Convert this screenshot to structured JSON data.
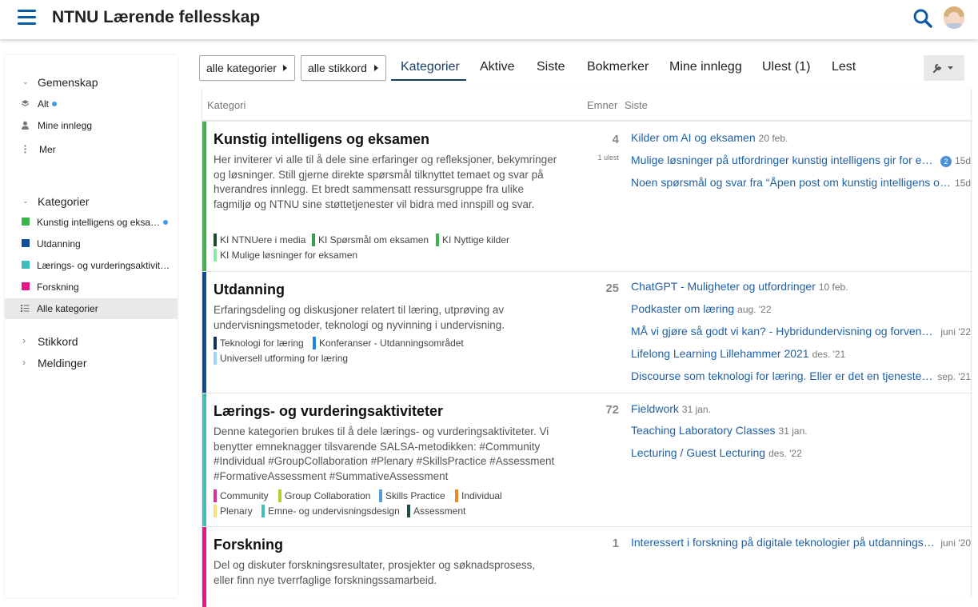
{
  "site_title": "NTNU Lærende fellesskap",
  "sidebar": {
    "community_label": "Gemenskap",
    "community_items": [
      {
        "label": "Alt",
        "icon": "layers-icon",
        "has_dot": true
      },
      {
        "label": "Mine innlegg",
        "icon": "user-icon",
        "has_dot": false
      },
      {
        "label": "Mer",
        "icon": "more-vertical-icon",
        "has_dot": false
      }
    ],
    "categories_label": "Kategorier",
    "category_items": [
      {
        "label": "Kunstig intelligens og eksa…",
        "color": "#3ab54a",
        "has_dot": true
      },
      {
        "label": "Utdanning",
        "color": "#0e4d9b",
        "has_dot": false
      },
      {
        "label": "Lærings- og vurderingsaktivit…",
        "color": "#3ebfbd",
        "has_dot": false
      },
      {
        "label": "Forskning",
        "color": "#e9158c",
        "has_dot": false
      },
      {
        "label": "Alle kategorier",
        "icon": "list-icon",
        "active": true
      }
    ],
    "tags_label": "Stikkord",
    "messages_label": "Meldinger"
  },
  "nav": {
    "categories_dropdown": "alle kategorier",
    "tags_dropdown": "alle stikkord",
    "tabs": [
      "Kategorier",
      "Aktive",
      "Siste",
      "Bokmerker",
      "Mine innlegg",
      "Ulest (1)",
      "Lest"
    ],
    "active_tab": "Kategorier"
  },
  "table_headers": {
    "category": "Kategori",
    "topics": "Emner",
    "latest": "Siste"
  },
  "categories": [
    {
      "title": "Kunstig intelligens og eksamen",
      "color": "#3ab54a",
      "description": "Her inviterer vi alle til å dele sine erfaringer og refleksjoner, bekymringer og løsninger. Still gjerne direkte spørsmål tilknyttet temaet og svar på hverandres innlegg. Et bredt sammensatt ressursgruppe fra ulike fagmiljø og NTNU sine støttetjenester vil bidra med innspill og svar.",
      "subcategories": [
        {
          "label": "KI NTNUere i media",
          "color": "#1f4d2c"
        },
        {
          "label": "KI Spørsmål om eksamen",
          "color": "#3a9d53"
        },
        {
          "label": "KI Nyttige kilder",
          "color": "#3ab54a"
        },
        {
          "label": "KI Mulige løsninger for eksamen",
          "color": "#8de6a0"
        }
      ],
      "topic_count": "4",
      "unread": "1 ulest",
      "topics": [
        {
          "title": "Kilder om AI og eksamen",
          "date": "20 feb.",
          "badge": ""
        },
        {
          "title": "Mulige løsninger på utfordringer kunstig intelligens gir for eksamen",
          "date": "15d",
          "badge": "2"
        },
        {
          "title": "Noen spørsmål og svar fra “Åpen post om kunstig intelligens og eksamen”",
          "date": "15d",
          "badge": ""
        }
      ]
    },
    {
      "title": "Utdanning",
      "color": "#0e4d9b",
      "description": "Erfaringsdeling og diskusjoner relatert til læring, utprøving av undervisningsmetoder, teknologi og nyvinning i undervisning.",
      "subcategories": [
        {
          "label": "Teknologi for læring",
          "color": "#15315b"
        },
        {
          "label": "Konferanser - Utdanningsområdet",
          "color": "#1b86e6"
        },
        {
          "label": "Universell utforming for læring",
          "color": "#9fd3f5"
        }
      ],
      "topic_count": "25",
      "unread": "",
      "topics": [
        {
          "title": "ChatGPT - Muligheter og utfordringer",
          "date": "10 feb.",
          "badge": ""
        },
        {
          "title": "Podkaster om læring",
          "date": "aug. '22",
          "badge": ""
        },
        {
          "title": "MÅ vi gjøre så godt vi kan? - Hybridundervisning og forventninger",
          "date": "juni '22",
          "badge": ""
        },
        {
          "title": "Lifelong Learning Lillehammer 2021",
          "date": "des. '21",
          "badge": ""
        },
        {
          "title": "Discourse som teknologi for læring. Eller er det en tjeneste? Eller begge deler?",
          "date": "sep. '21",
          "badge": ""
        }
      ]
    },
    {
      "title": "Lærings- og vurderingsaktiviteter",
      "color": "#3ebfbd",
      "description": "Denne kategorien brukes til å dele lærings- og vurderingsaktiviteter. Vi benytter emneknagger tilsvarende SALSA-metodikken: #Community #Individual #GroupCollaboration #Plenary #SkillsPractice #Assessment #FormativeAssessment #SummativeAssessment",
      "subcategories": [
        {
          "label": "Community",
          "color": "#d2349b"
        },
        {
          "label": "Group Collaboration",
          "color": "#b5cf2a"
        },
        {
          "label": "Skills Practice",
          "color": "#5b9bd5"
        },
        {
          "label": "Individual",
          "color": "#e98b2a"
        },
        {
          "label": "Plenary",
          "color": "#f5e27a"
        },
        {
          "label": "Emne- og undervisningsdesign",
          "color": "#3ebfbd"
        },
        {
          "label": "Assessment",
          "color": "#1d4e4e"
        }
      ],
      "topic_count": "72",
      "unread": "",
      "topics": [
        {
          "title": "Fieldwork",
          "date": "31 jan.",
          "badge": ""
        },
        {
          "title": "Teaching Laboratory Classes",
          "date": "31 jan.",
          "badge": ""
        },
        {
          "title": "Lecturing / Guest Lecturing",
          "date": "des. '22",
          "badge": ""
        }
      ]
    },
    {
      "title": "Forskning",
      "color": "#e9158c",
      "description": "Del og diskuter forskningsresultater, prosjekter og søknadsprosess, eller finn nye tverrfaglige forskningssamarbeid.",
      "subcategories": [],
      "topic_count": "1",
      "unread": "",
      "topics": [
        {
          "title": "Interessert i forskning på digitale teknologier på utdanningsområdet",
          "date": "juni '20",
          "badge": ""
        }
      ]
    }
  ]
}
